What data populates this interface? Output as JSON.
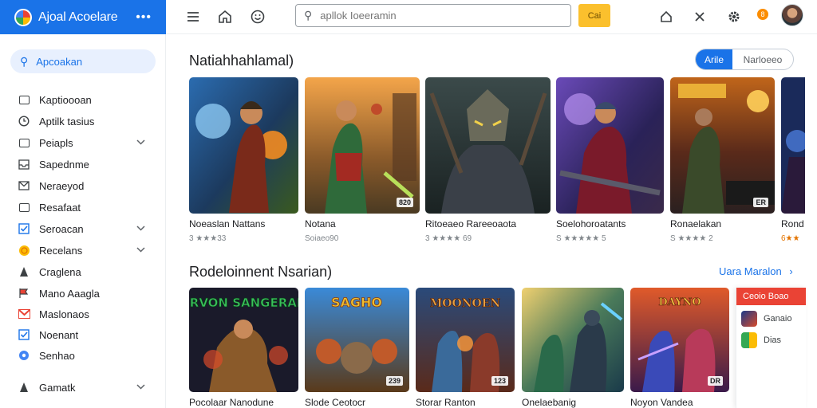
{
  "brand": {
    "title": "Ajoal Acoelare",
    "more": "•••"
  },
  "topbar": {
    "search_placeholder": "apllok Ioeeramin",
    "yellow_button": "Cai",
    "notif_count": "8"
  },
  "sidebar": {
    "search_label": "Apcoakan",
    "items": [
      {
        "label": "Kaptioooan",
        "icon": "box-icon"
      },
      {
        "label": "Aptilk tasius",
        "icon": "clock-icon"
      },
      {
        "label": "Peiapls",
        "icon": "box-icon",
        "chevron": "⌄"
      },
      {
        "label": "Sapednme",
        "icon": "inbox-icon"
      },
      {
        "label": "Neraeyod",
        "icon": "mail-icon"
      },
      {
        "label": "Resafaat",
        "icon": "box-icon"
      },
      {
        "label": "Seroacan",
        "icon": "check-box-icon",
        "chevron": "⌄"
      },
      {
        "label": "Recelans",
        "icon": "coin-icon",
        "chevron": "⌄"
      },
      {
        "label": "Craglena",
        "icon": "person-icon"
      },
      {
        "label": "Mano Aaagla",
        "icon": "flag-icon"
      },
      {
        "label": "Maslonaos",
        "icon": "gmail-icon"
      },
      {
        "label": "Noenant",
        "icon": "check-box-icon"
      },
      {
        "label": "Senhao",
        "icon": "settings-icon"
      },
      {
        "label": "Gamatk",
        "icon": "person-icon",
        "chevron": "⌄"
      }
    ]
  },
  "section1": {
    "title": "Natiahhahlamal)",
    "toggle_on": "Arile",
    "toggle_off": "Narloeeo",
    "cards": [
      {
        "title": "Noeaslan Nattans",
        "sub": "3 ★★★33",
        "badge": ""
      },
      {
        "title": "Notana",
        "sub": "Soiaeo90",
        "badge": "820"
      },
      {
        "title": "Ritoeaeo Rareeoaota",
        "sub": "3 ★★★★ 69",
        "badge": ""
      },
      {
        "title": "Soelohoroatants",
        "sub": "S ★★★★★ 5",
        "badge": ""
      },
      {
        "title": "Ronaelakan",
        "sub": "S ★★★★ 2",
        "badge": "ER"
      },
      {
        "title": "Rond",
        "sub": "6★★",
        "badge": ""
      }
    ]
  },
  "section2": {
    "title": "Rodeloinnent Nsarian)",
    "view_more": "Uara Maralon",
    "cards": [
      {
        "title": "Pocolaar Nanodune",
        "badge": "",
        "art": "SURVON SANGERANS"
      },
      {
        "title": "Slode Ceotocr",
        "badge": "239",
        "art": "SAGHO"
      },
      {
        "title": "Storar Ranton",
        "badge": "123",
        "art": "MOONOEN"
      },
      {
        "title": "Onelaebanig",
        "badge": "",
        "art": ""
      },
      {
        "title": "Noyon Vandea",
        "badge": "DR",
        "art": "DAYNO"
      }
    ]
  },
  "popup": {
    "header": "Ceoio Boao",
    "items": [
      {
        "label": "Ganaio"
      },
      {
        "label": "Dias"
      }
    ]
  },
  "colors": {
    "accent": "#1a73e8",
    "yellow": "#fbc02d",
    "red": "#ea4335"
  }
}
